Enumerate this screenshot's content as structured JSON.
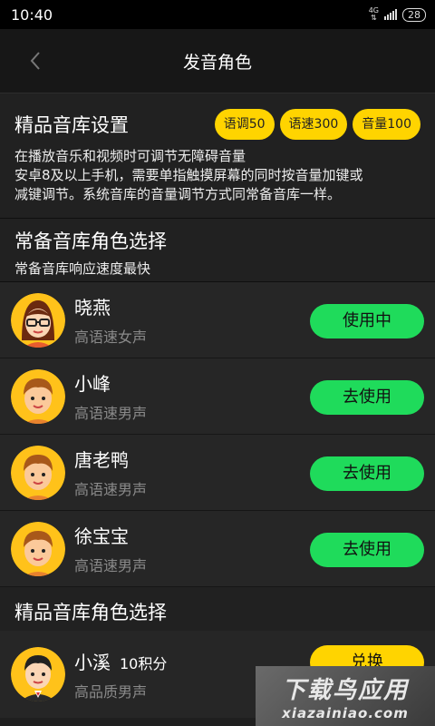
{
  "status_bar": {
    "time": "10:40",
    "network": "4G",
    "battery": "28"
  },
  "header": {
    "title": "发音角色"
  },
  "premium_settings": {
    "title": "精品音库设置",
    "pills": [
      "语调50",
      "语速300",
      "音量100"
    ],
    "description_lines": [
      "在播放音乐和视频时可调节无障碍音量",
      "安卓8及以上手机，需要单指触摸屏幕的同时按音量加键或",
      "减键调节。系统音库的音量调节方式同常备音库一样。"
    ]
  },
  "common_section": {
    "title": "常备音库角色选择",
    "subtitle": "常备音库响应速度最快"
  },
  "common_voices": [
    {
      "name": "晓燕",
      "desc": "高语速女声",
      "button": "使用中"
    },
    {
      "name": "小峰",
      "desc": "高语速男声",
      "button": "去使用"
    },
    {
      "name": "唐老鸭",
      "desc": "高语速男声",
      "button": "去使用"
    },
    {
      "name": "徐宝宝",
      "desc": "高语速男声",
      "button": "去使用"
    }
  ],
  "premium_section": {
    "title": "精品音库角色选择"
  },
  "premium_voices": [
    {
      "name": "小溪",
      "points": "10积分",
      "desc": "高品质男声",
      "button": "兑换"
    }
  ],
  "watermark": {
    "line1": "下载鸟应用",
    "line2": "xiazainiao.com"
  },
  "colors": {
    "green": "#1fdb5b",
    "yellow": "#ffd400",
    "background": "#1f1f1f"
  }
}
